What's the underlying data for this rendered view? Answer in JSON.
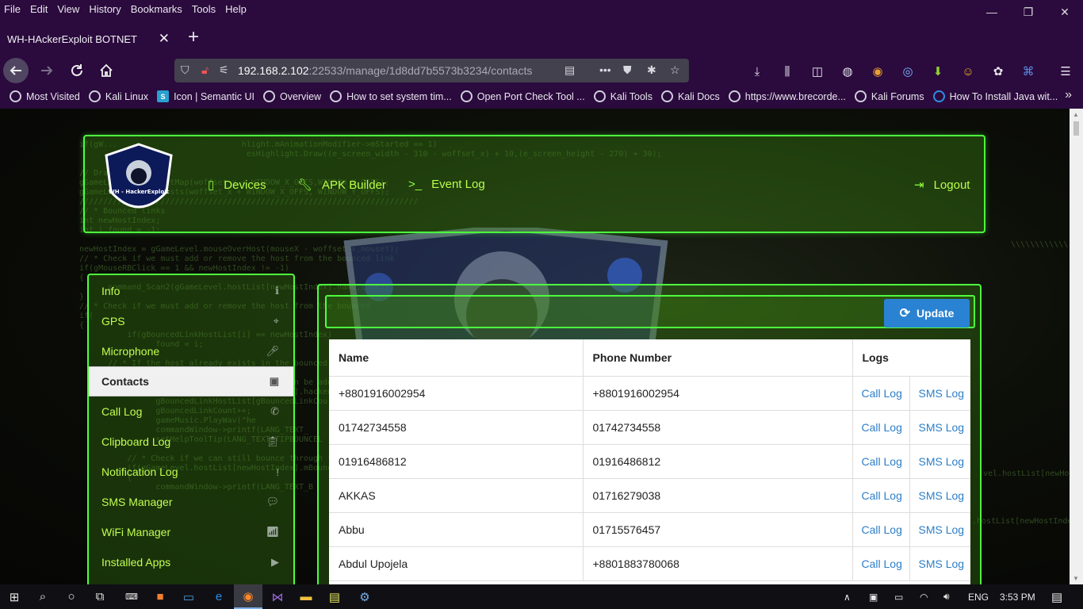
{
  "menu": [
    "File",
    "Edit",
    "View",
    "History",
    "Bookmarks",
    "Tools",
    "Help"
  ],
  "window_controls": {
    "minimize": "—",
    "restore": "❐",
    "close": "✕"
  },
  "tab": {
    "title": "WH-HAckerExploit BOTNET",
    "close": "✕",
    "new_tab": "+"
  },
  "url": {
    "host": "192.168.2.102",
    "rest": ":22533/manage/1d8dd7b5573b3234/contacts"
  },
  "bookmarks": [
    {
      "label": "Most Visited",
      "icon": "gear-icon"
    },
    {
      "label": "Kali Linux",
      "icon": "globe-icon"
    },
    {
      "label": "Icon | Semantic UI",
      "icon": "semantic-s-icon"
    },
    {
      "label": "Overview",
      "icon": "globe-icon"
    },
    {
      "label": "How to set system tim...",
      "icon": "globe-icon"
    },
    {
      "label": "Open Port Check Tool ...",
      "icon": "globe-icon"
    },
    {
      "label": "Kali Tools",
      "icon": "globe-icon"
    },
    {
      "label": "Kali Docs",
      "icon": "globe-icon"
    },
    {
      "label": "https://www.brecorde...",
      "icon": "globe-icon"
    },
    {
      "label": "Kali Forums",
      "icon": "globe-icon"
    },
    {
      "label": "How To Install Java wit...",
      "icon": "dragon-icon"
    }
  ],
  "header": {
    "logo_text": "WH - HackerExploit",
    "nav": [
      {
        "label": "Devices",
        "icon": "mobile-icon"
      },
      {
        "label": "APK Builder",
        "icon": "wrench-icon"
      },
      {
        "label": "Event Log",
        "icon": "terminal-icon"
      }
    ],
    "logout": "Logout"
  },
  "sidebar": [
    {
      "label": "Info",
      "icon": "info-icon",
      "active": false
    },
    {
      "label": "GPS",
      "icon": "map-marker-icon",
      "active": false
    },
    {
      "label": "Microphone",
      "icon": "microphone-icon",
      "active": false
    },
    {
      "label": "Contacts",
      "icon": "address-book-icon",
      "active": true
    },
    {
      "label": "Call Log",
      "icon": "phone-icon",
      "active": false
    },
    {
      "label": "Clipboard Log",
      "icon": "clipboard-icon",
      "active": false
    },
    {
      "label": "Notification Log",
      "icon": "exclamation-icon",
      "active": false
    },
    {
      "label": "SMS Manager",
      "icon": "chat-icon",
      "active": false
    },
    {
      "label": "WiFi Manager",
      "icon": "wifi-icon",
      "active": false
    },
    {
      "label": "Installed Apps",
      "icon": "play-icon",
      "active": false
    }
  ],
  "contacts": {
    "update_label": "Update",
    "columns": [
      "Name",
      "Phone Number",
      "Logs"
    ],
    "call_log_label": "Call Log",
    "sms_log_label": "SMS Log",
    "rows": [
      {
        "name": "+8801916002954",
        "phone": "+8801916002954"
      },
      {
        "name": "01742734558",
        "phone": "01742734558"
      },
      {
        "name": "01916486812",
        "phone": "01916486812"
      },
      {
        "name": "AKKAS",
        "phone": "01716279038"
      },
      {
        "name": "Abbu",
        "phone": "01715576457"
      },
      {
        "name": "Abdul Upojela",
        "phone": "+8801883780068"
      }
    ]
  },
  "taskbar": {
    "language": "ENG",
    "time": "3:53 PM"
  },
  "colors": {
    "neon_green": "#4dff3f",
    "chrome_bg": "#2b0a3d",
    "update_button": "#2a82d2",
    "link": "#2c7ec8"
  }
}
